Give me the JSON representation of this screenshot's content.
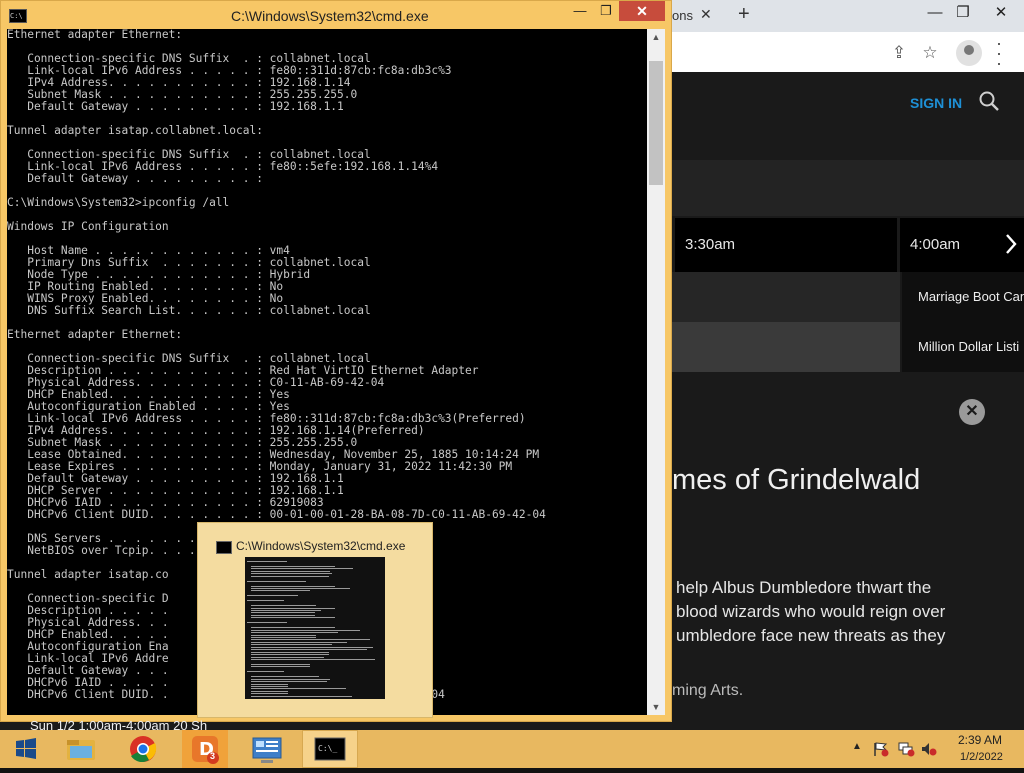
{
  "browser": {
    "tab_partial": "ons",
    "tab_close": "✕",
    "new_tab": "+",
    "controls": {
      "minimize": "—",
      "restore": "❐",
      "close": "✕"
    },
    "header": {
      "sign_in": "SIGN IN"
    },
    "schedule": {
      "times": [
        "3:30am",
        "4:00am"
      ],
      "shows": [
        "Marriage Boot Can",
        "Million Dollar Listi"
      ]
    },
    "movie": {
      "title": "mes of Grindelwald",
      "description": [
        "help Albus Dumbledore thwart the",
        "blood wizards who would reign over",
        "umbledore face new threats as they"
      ],
      "credit": "ming Arts."
    }
  },
  "cmd": {
    "title": "C:\\Windows\\System32\\cmd.exe",
    "controls": {
      "minimize": "—",
      "restore": "❐",
      "close": "✕"
    },
    "lines": [
      "Ethernet adapter Ethernet:",
      "",
      "   Connection-specific DNS Suffix  . : collabnet.local",
      "   Link-local IPv6 Address . . . . . : fe80::311d:87cb:fc8a:db3c%3",
      "   IPv4 Address. . . . . . . . . . . : 192.168.1.14",
      "   Subnet Mask . . . . . . . . . . . : 255.255.255.0",
      "   Default Gateway . . . . . . . . . : 192.168.1.1",
      "",
      "Tunnel adapter isatap.collabnet.local:",
      "",
      "   Connection-specific DNS Suffix  . : collabnet.local",
      "   Link-local IPv6 Address . . . . . : fe80::5efe:192.168.1.14%4",
      "   Default Gateway . . . . . . . . . :",
      "",
      "C:\\Windows\\System32>ipconfig /all",
      "",
      "Windows IP Configuration",
      "",
      "   Host Name . . . . . . . . . . . . : vm4",
      "   Primary Dns Suffix  . . . . . . . : collabnet.local",
      "   Node Type . . . . . . . . . . . . : Hybrid",
      "   IP Routing Enabled. . . . . . . . : No",
      "   WINS Proxy Enabled. . . . . . . . : No",
      "   DNS Suffix Search List. . . . . . : collabnet.local",
      "",
      "Ethernet adapter Ethernet:",
      "",
      "   Connection-specific DNS Suffix  . : collabnet.local",
      "   Description . . . . . . . . . . . : Red Hat VirtIO Ethernet Adapter",
      "   Physical Address. . . . . . . . . : C0-11-AB-69-42-04",
      "   DHCP Enabled. . . . . . . . . . . : Yes",
      "   Autoconfiguration Enabled . . . . : Yes",
      "   Link-local IPv6 Address . . . . . : fe80::311d:87cb:fc8a:db3c%3(Preferred)",
      "   IPv4 Address. . . . . . . . . . . : 192.168.1.14(Preferred)",
      "   Subnet Mask . . . . . . . . . . . : 255.255.255.0",
      "   Lease Obtained. . . . . . . . . . : Wednesday, November 25, 1885 10:14:24 PM",
      "   Lease Expires . . . . . . . . . . : Monday, January 31, 2022 11:42:30 PM",
      "   Default Gateway . . . . . . . . . : 192.168.1.1",
      "   DHCP Server . . . . . . . . . . . : 192.168.1.1",
      "   DHCPv6 IAID . . . . . . . . . . . : 62919083",
      "   DHCPv6 Client DUID. . . . . . . . : 00-01-00-01-28-BA-08-7D-C0-11-AB-69-42-04",
      "",
      "   DNS Servers . . . . . . . . . . . :",
      "   NetBIOS over Tcpip. . . . . . . . :",
      "",
      "Tunnel adapter isatap.co                  ",
      "",
      "   Connection-specific D                   l",
      "   Description . . . . .                 AP Adapter",
      "   Physical Address. . .                -00-00-E0",
      "   DHCP Enabled. . . . .",
      "   Autoconfiguration Ena",
      "   Link-local IPv6 Addre               .168.1.14%4(Preferred)",
      "   Default Gateway . . .",
      "   DHCPv6 IAID . . . . .",
      "   DHCPv6 Client DUID. .               BA-08-7D-C0-11-AB-69-42-04"
    ]
  },
  "behind_text": "Sun 1/2 1:00am-4:00am  20  Sh",
  "preview": {
    "title": "C:\\Windows\\System32\\cmd.exe"
  },
  "taskbar": {
    "apps": [
      "windows-start",
      "file-explorer",
      "chrome",
      "d3-app",
      "control-panel",
      "command-prompt"
    ],
    "d3_badge": "3",
    "clock": {
      "time": "2:39 AM",
      "date": "1/2/2022"
    }
  },
  "colors": {
    "cmd_frame": "#f7c766",
    "taskbar": "#e8b860",
    "close_red": "#c74c3c",
    "link_blue": "#1e90d6"
  }
}
